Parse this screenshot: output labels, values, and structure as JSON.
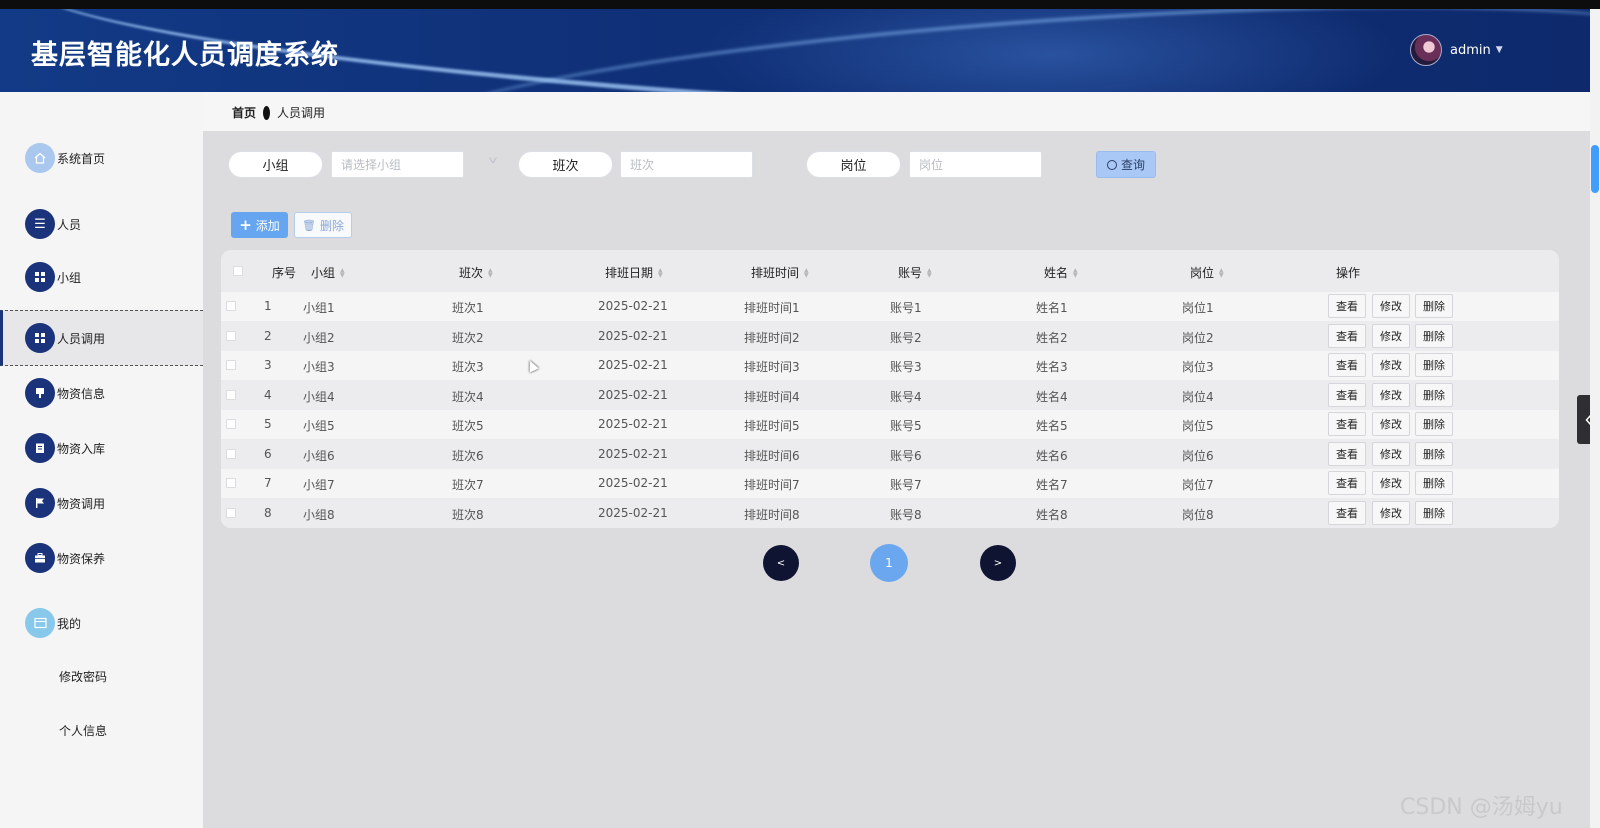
{
  "app": {
    "title": "基层智能化人员调度系统",
    "user": "admin"
  },
  "sidebar": {
    "items": [
      {
        "label": "系统首页",
        "icon": "home-icon"
      },
      {
        "label": "人员",
        "icon": "list-icon"
      },
      {
        "label": "小组",
        "icon": "grid-icon"
      },
      {
        "label": "人员调用",
        "icon": "grid-icon",
        "active": true
      },
      {
        "label": "物资信息",
        "icon": "tag-icon"
      },
      {
        "label": "物资入库",
        "icon": "clipboard-icon"
      },
      {
        "label": "物资调用",
        "icon": "flag-icon"
      },
      {
        "label": "物资保养",
        "icon": "briefcase-icon"
      },
      {
        "label": "我的",
        "icon": "card-icon"
      }
    ],
    "sub_items": [
      {
        "label": "修改密码"
      },
      {
        "label": "个人信息"
      }
    ]
  },
  "breadcrumb": {
    "home": "首页",
    "current": "人员调用"
  },
  "search": {
    "group_label": "小组",
    "group_placeholder": "请选择小组",
    "shift_label": "班次",
    "shift_placeholder": "班次",
    "post_label": "岗位",
    "post_placeholder": "岗位",
    "query_label": "查询"
  },
  "toolbar": {
    "add_label": "添加",
    "delete_label": "删除"
  },
  "table": {
    "columns": [
      "序号",
      "小组",
      "班次",
      "排班日期",
      "排班时间",
      "账号",
      "姓名",
      "岗位",
      "操作"
    ],
    "rows": [
      {
        "no": "1",
        "group": "小组1",
        "shift": "班次1",
        "date": "2025-02-21",
        "time": "排班时间1",
        "account": "账号1",
        "name": "姓名1",
        "post": "岗位1"
      },
      {
        "no": "2",
        "group": "小组2",
        "shift": "班次2",
        "date": "2025-02-21",
        "time": "排班时间2",
        "account": "账号2",
        "name": "姓名2",
        "post": "岗位2"
      },
      {
        "no": "3",
        "group": "小组3",
        "shift": "班次3",
        "date": "2025-02-21",
        "time": "排班时间3",
        "account": "账号3",
        "name": "姓名3",
        "post": "岗位3"
      },
      {
        "no": "4",
        "group": "小组4",
        "shift": "班次4",
        "date": "2025-02-21",
        "time": "排班时间4",
        "account": "账号4",
        "name": "姓名4",
        "post": "岗位4"
      },
      {
        "no": "5",
        "group": "小组5",
        "shift": "班次5",
        "date": "2025-02-21",
        "time": "排班时间5",
        "account": "账号5",
        "name": "姓名5",
        "post": "岗位5"
      },
      {
        "no": "6",
        "group": "小组6",
        "shift": "班次6",
        "date": "2025-02-21",
        "time": "排班时间6",
        "account": "账号6",
        "name": "姓名6",
        "post": "岗位6"
      },
      {
        "no": "7",
        "group": "小组7",
        "shift": "班次7",
        "date": "2025-02-21",
        "time": "排班时间7",
        "account": "账号7",
        "name": "姓名7",
        "post": "岗位7"
      },
      {
        "no": "8",
        "group": "小组8",
        "shift": "班次8",
        "date": "2025-02-21",
        "time": "排班时间8",
        "account": "账号8",
        "name": "姓名8",
        "post": "岗位8"
      }
    ],
    "actions": {
      "view": "查看",
      "edit": "修改",
      "delete": "删除"
    }
  },
  "pagination": {
    "prev": "<",
    "current": "1",
    "next": ">"
  },
  "watermark": "CSDN @汤姆yu",
  "colors": {
    "header": "#0f2f76",
    "primary": "#409eff",
    "sidebar_icon": "#1a337a"
  }
}
